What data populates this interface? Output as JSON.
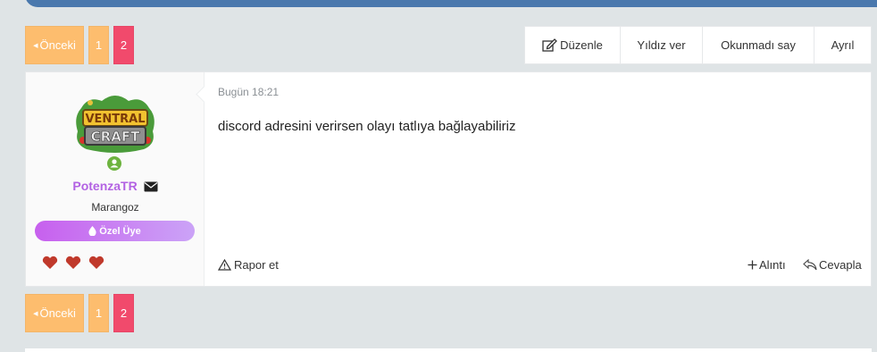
{
  "pagination": {
    "prev_label": "Önceki",
    "pages": [
      "1",
      "2"
    ],
    "current_page": "2"
  },
  "thread_actions": {
    "edit": "Düzenle",
    "star": "Yıldız ver",
    "unread": "Okunmadı say",
    "leave": "Ayrıl"
  },
  "post": {
    "author": {
      "name": "PotenzaTR",
      "title": "Marangoz",
      "badge": "Özel Üye",
      "avatar_text_top": "VENTRAL",
      "avatar_text_bottom": "CRAFT",
      "hearts": 3,
      "name_color": "#b362e3"
    },
    "date": "Bugün 18:21",
    "message": "discord adresini verirsen olayı tatlıya bağlayabiliriz",
    "report_label": "Rapor et",
    "quote_label": "Alıntı",
    "reply_label": "Cevapla"
  },
  "colors": {
    "accent_orange": "#fdbd6e",
    "accent_pink": "#f14a6c",
    "header_blue": "#4a78ad",
    "heart_red": "#c0392b",
    "online_green": "#6db33f"
  }
}
